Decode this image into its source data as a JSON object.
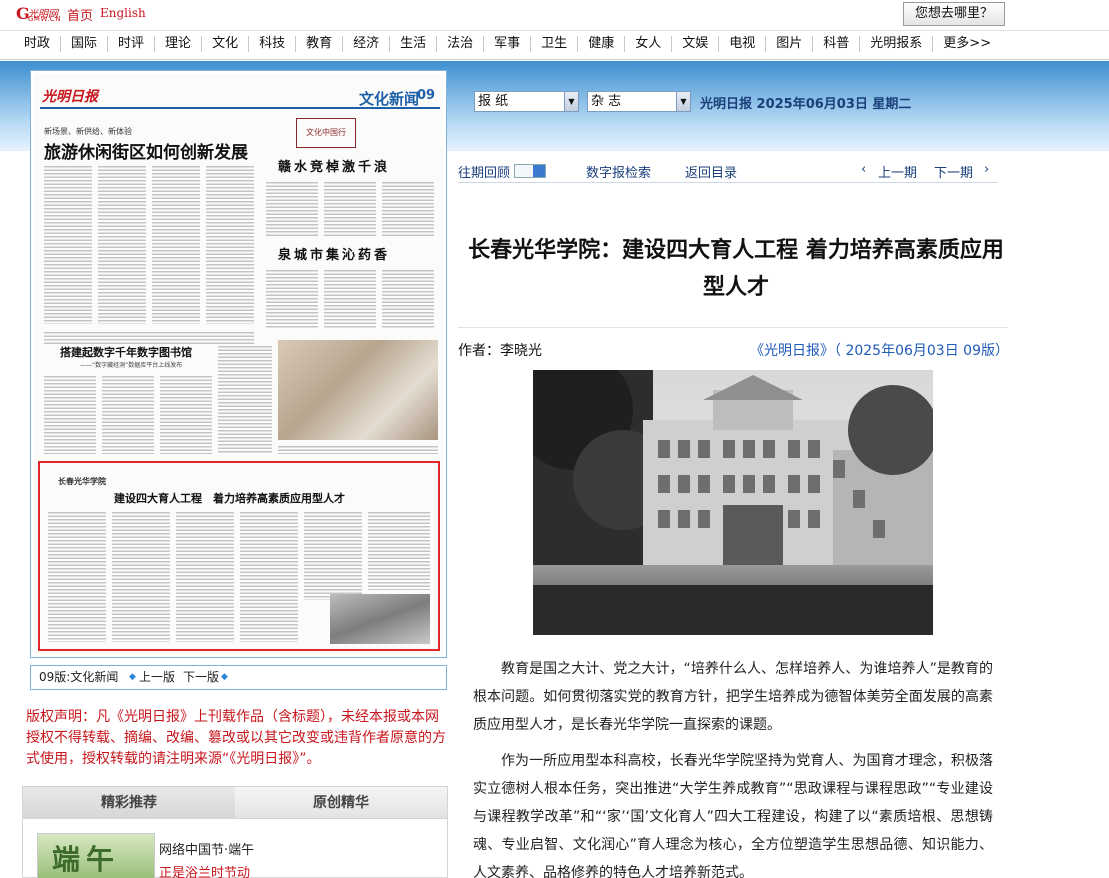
{
  "header": {
    "logo_text": "光明网",
    "logo_sub": "GMW.CN",
    "home_link": "首页",
    "english_link": "English",
    "goto_button": "您想去哪里？"
  },
  "nav": [
    "时政",
    "国际",
    "时评",
    "理论",
    "文化",
    "科技",
    "教育",
    "经济",
    "生活",
    "法治",
    "军事",
    "卫生",
    "健康",
    "女人",
    "文娱",
    "电视",
    "图片",
    "科普",
    "光明报系",
    "更多>>"
  ],
  "paper": {
    "masthead": "光明日报",
    "section": "文化新闻",
    "page_no": "09",
    "kicker1": "新场景、新供给、新体验",
    "headline1": "旅游休闲街区如何创新发展",
    "seal": "文化中国行",
    "headline2": "赣水竞棹激千浪",
    "headline3": "泉城市集沁药香",
    "headline4": "搭建起数字千年数字图书馆",
    "sub4": "——“数字藏经洞”数据库平台上线发布",
    "box_kicker": "长春光华学院",
    "box_headline": "建设四大育人工程　着力培养高素质应用型人才"
  },
  "pager": {
    "edition": "09版:文化新闻",
    "prev": "上一版",
    "next": "下一版"
  },
  "copyright": "版权声明：凡《光明日报》上刊载作品（含标题），未经本报或本网授权不得转载、摘编、改编、篡改或以其它改变或违背作者原意的方式使用，授权转载的请注明来源“《光明日报》”。",
  "recommend": {
    "tab_active": "精彩推荐",
    "tab_other": "原创精华",
    "thumb_text": "端午",
    "item_title": "网络中国节·端午",
    "item_sub": "正是浴兰时节动"
  },
  "selectors": {
    "paper": "报  纸",
    "magazine": "杂  志"
  },
  "date_line": "光明日报 2025年06月03日 星期二",
  "tools": {
    "archive": "往期回顾",
    "digital_search": "数字报检索",
    "back": "返回目录",
    "prev_issue": "上一期",
    "next_issue": "下一期",
    "prev_arrow": "‹",
    "next_arrow": "›"
  },
  "article": {
    "title": "长春光华学院：建设四大育人工程 着力培养高素质应用型人才",
    "author": "作者：李晓光",
    "source": "《光明日报》（ 2025年06月03日 09版）",
    "paragraphs": [
      "教育是国之大计、党之大计，“培养什么人、怎样培养人、为谁培养人”是教育的根本问题。如何贯彻落实党的教育方针，把学生培养成为德智体美劳全面发展的高素质应用型人才，是长春光华学院一直探索的课题。",
      "作为一所应用型本科高校，长春光华学院坚持为党育人、为国育才理念，积极落实立德树人根本任务，突出推进“大学生养成教育”“思政课程与课程思政”“专业建设与课程教学改革”和“‘家’‘国’文化育人”四大工程建设，构建了以“素质培根、思想铸魂、专业启智、文化润心”育人理念为核心，全方位塑造学生思想品德、知识能力、人文素养、品格修养的特色人才培养新范式。"
    ]
  },
  "colors": {
    "brand_red": "#c8161d",
    "link_blue": "#1f5bb8",
    "band_blue": "#3d8fd0",
    "highlight_red": "#e0262b"
  }
}
